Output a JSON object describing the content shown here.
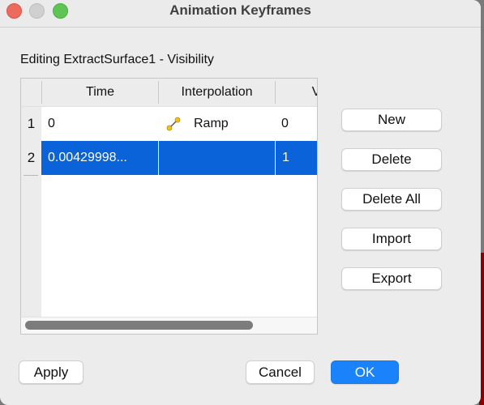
{
  "window": {
    "title": "Animation Keyframes",
    "controls": {
      "close_color": "#ed6a5e",
      "minimize_color": "#d0d0d0",
      "maximize_color": "#5fc454"
    }
  },
  "editing_label": "Editing ExtractSurface1 - Visibility",
  "table": {
    "columns": [
      "Time",
      "Interpolation",
      "V"
    ],
    "rows": [
      {
        "number": "1",
        "time": "0",
        "interpolation": "Ramp",
        "interpolation_icon": "ramp-icon",
        "value": "0",
        "selected": false
      },
      {
        "number": "2",
        "time": "0.00429998...",
        "interpolation": "",
        "interpolation_icon": "",
        "value": "1",
        "selected": true
      }
    ],
    "selection_color": "#0a63d8"
  },
  "side_buttons": {
    "new": "New",
    "delete": "Delete",
    "delete_all": "Delete All",
    "import": "Import",
    "export": "Export"
  },
  "footer": {
    "apply": "Apply",
    "cancel": "Cancel",
    "ok": "OK",
    "ok_color": "#1a82fb"
  }
}
